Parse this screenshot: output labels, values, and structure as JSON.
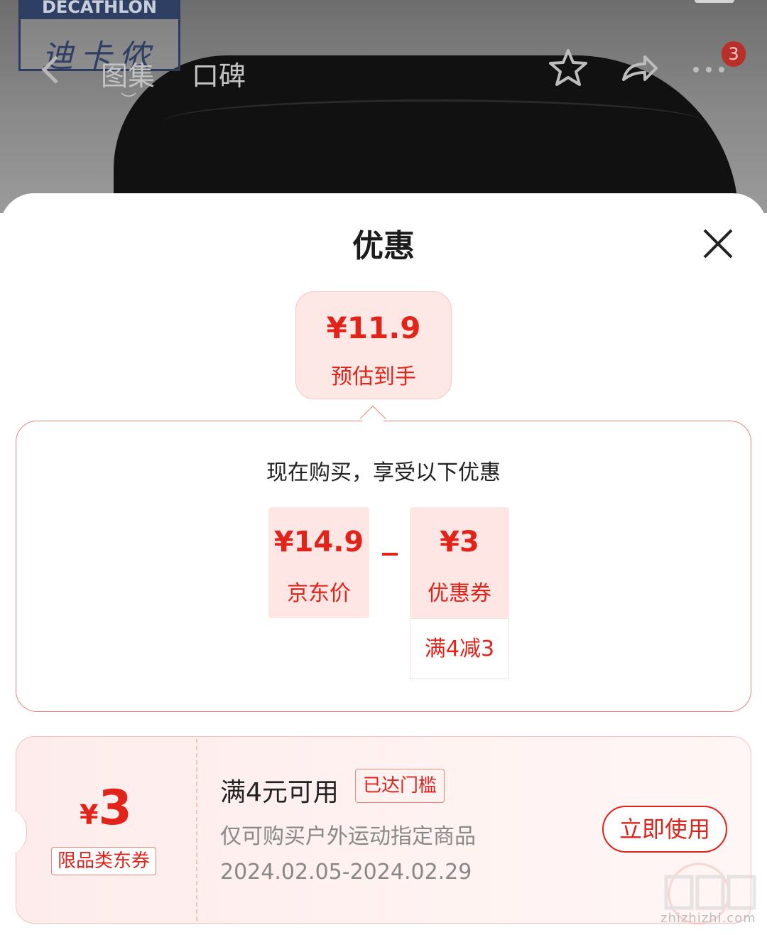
{
  "background_page": {
    "logo_text": "DECATHLON",
    "logo_cn": "迪卡侬",
    "tabs": [
      {
        "label": "图集"
      },
      {
        "label": "口碑"
      }
    ],
    "badge_count": "3"
  },
  "sheet": {
    "title": "优惠",
    "estimate": {
      "price": "¥11.9",
      "label": "预估到手"
    },
    "breakdown": {
      "heading": "现在购买，享受以下优惠",
      "jd_price": {
        "value": "¥14.9",
        "label": "京东价"
      },
      "coupon": {
        "value": "¥3",
        "label": "优惠券",
        "condition": "满4减3"
      }
    },
    "coupon_card": {
      "currency": "¥",
      "amount": "3",
      "type": "限品类东券",
      "threshold": "满4元可用",
      "status_tag": "已达门槛",
      "scope": "仅可购买户外运动指定商品",
      "dates": "2024.02.05-2024.02.29",
      "use_button": "立即使用"
    }
  },
  "watermark": "zhizhizhi.com",
  "colors": {
    "accent": "#e2231a",
    "accent_light": "#fde8e6",
    "border": "#e9867e"
  }
}
